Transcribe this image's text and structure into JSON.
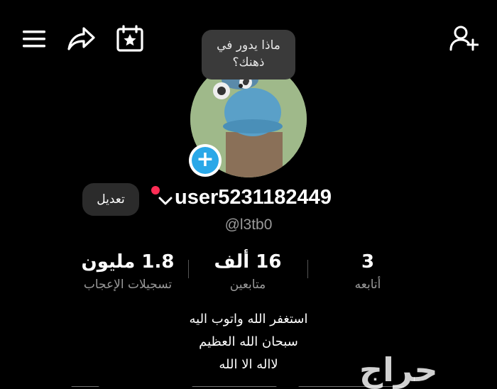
{
  "header": {
    "icons": [
      "menu-icon",
      "share-icon",
      "calendar-star-icon",
      "add-user-icon"
    ]
  },
  "avatar_tooltip": {
    "line1": "ماذا يدور في",
    "line2": "ذهنك؟"
  },
  "profile": {
    "edit_label": "تعديل",
    "username": "user5231182449",
    "handle": "@l3tb0"
  },
  "stats": [
    {
      "value": "1.8 مليون",
      "label": "تسجيلات الإعجاب"
    },
    {
      "value": "16 ألف",
      "label": "متابعين"
    },
    {
      "value": "3",
      "label": "أتابعه"
    }
  ],
  "bio": [
    "استغفر الله واتوب اليه",
    "سبحان الله العظيم",
    "لااله الا الله"
  ],
  "watermark": "حراج",
  "colors": {
    "background": "#000000",
    "accent_blue": "#2aa8e8",
    "notification_red": "#ff2d55",
    "muted_text": "#9a9a9a"
  }
}
